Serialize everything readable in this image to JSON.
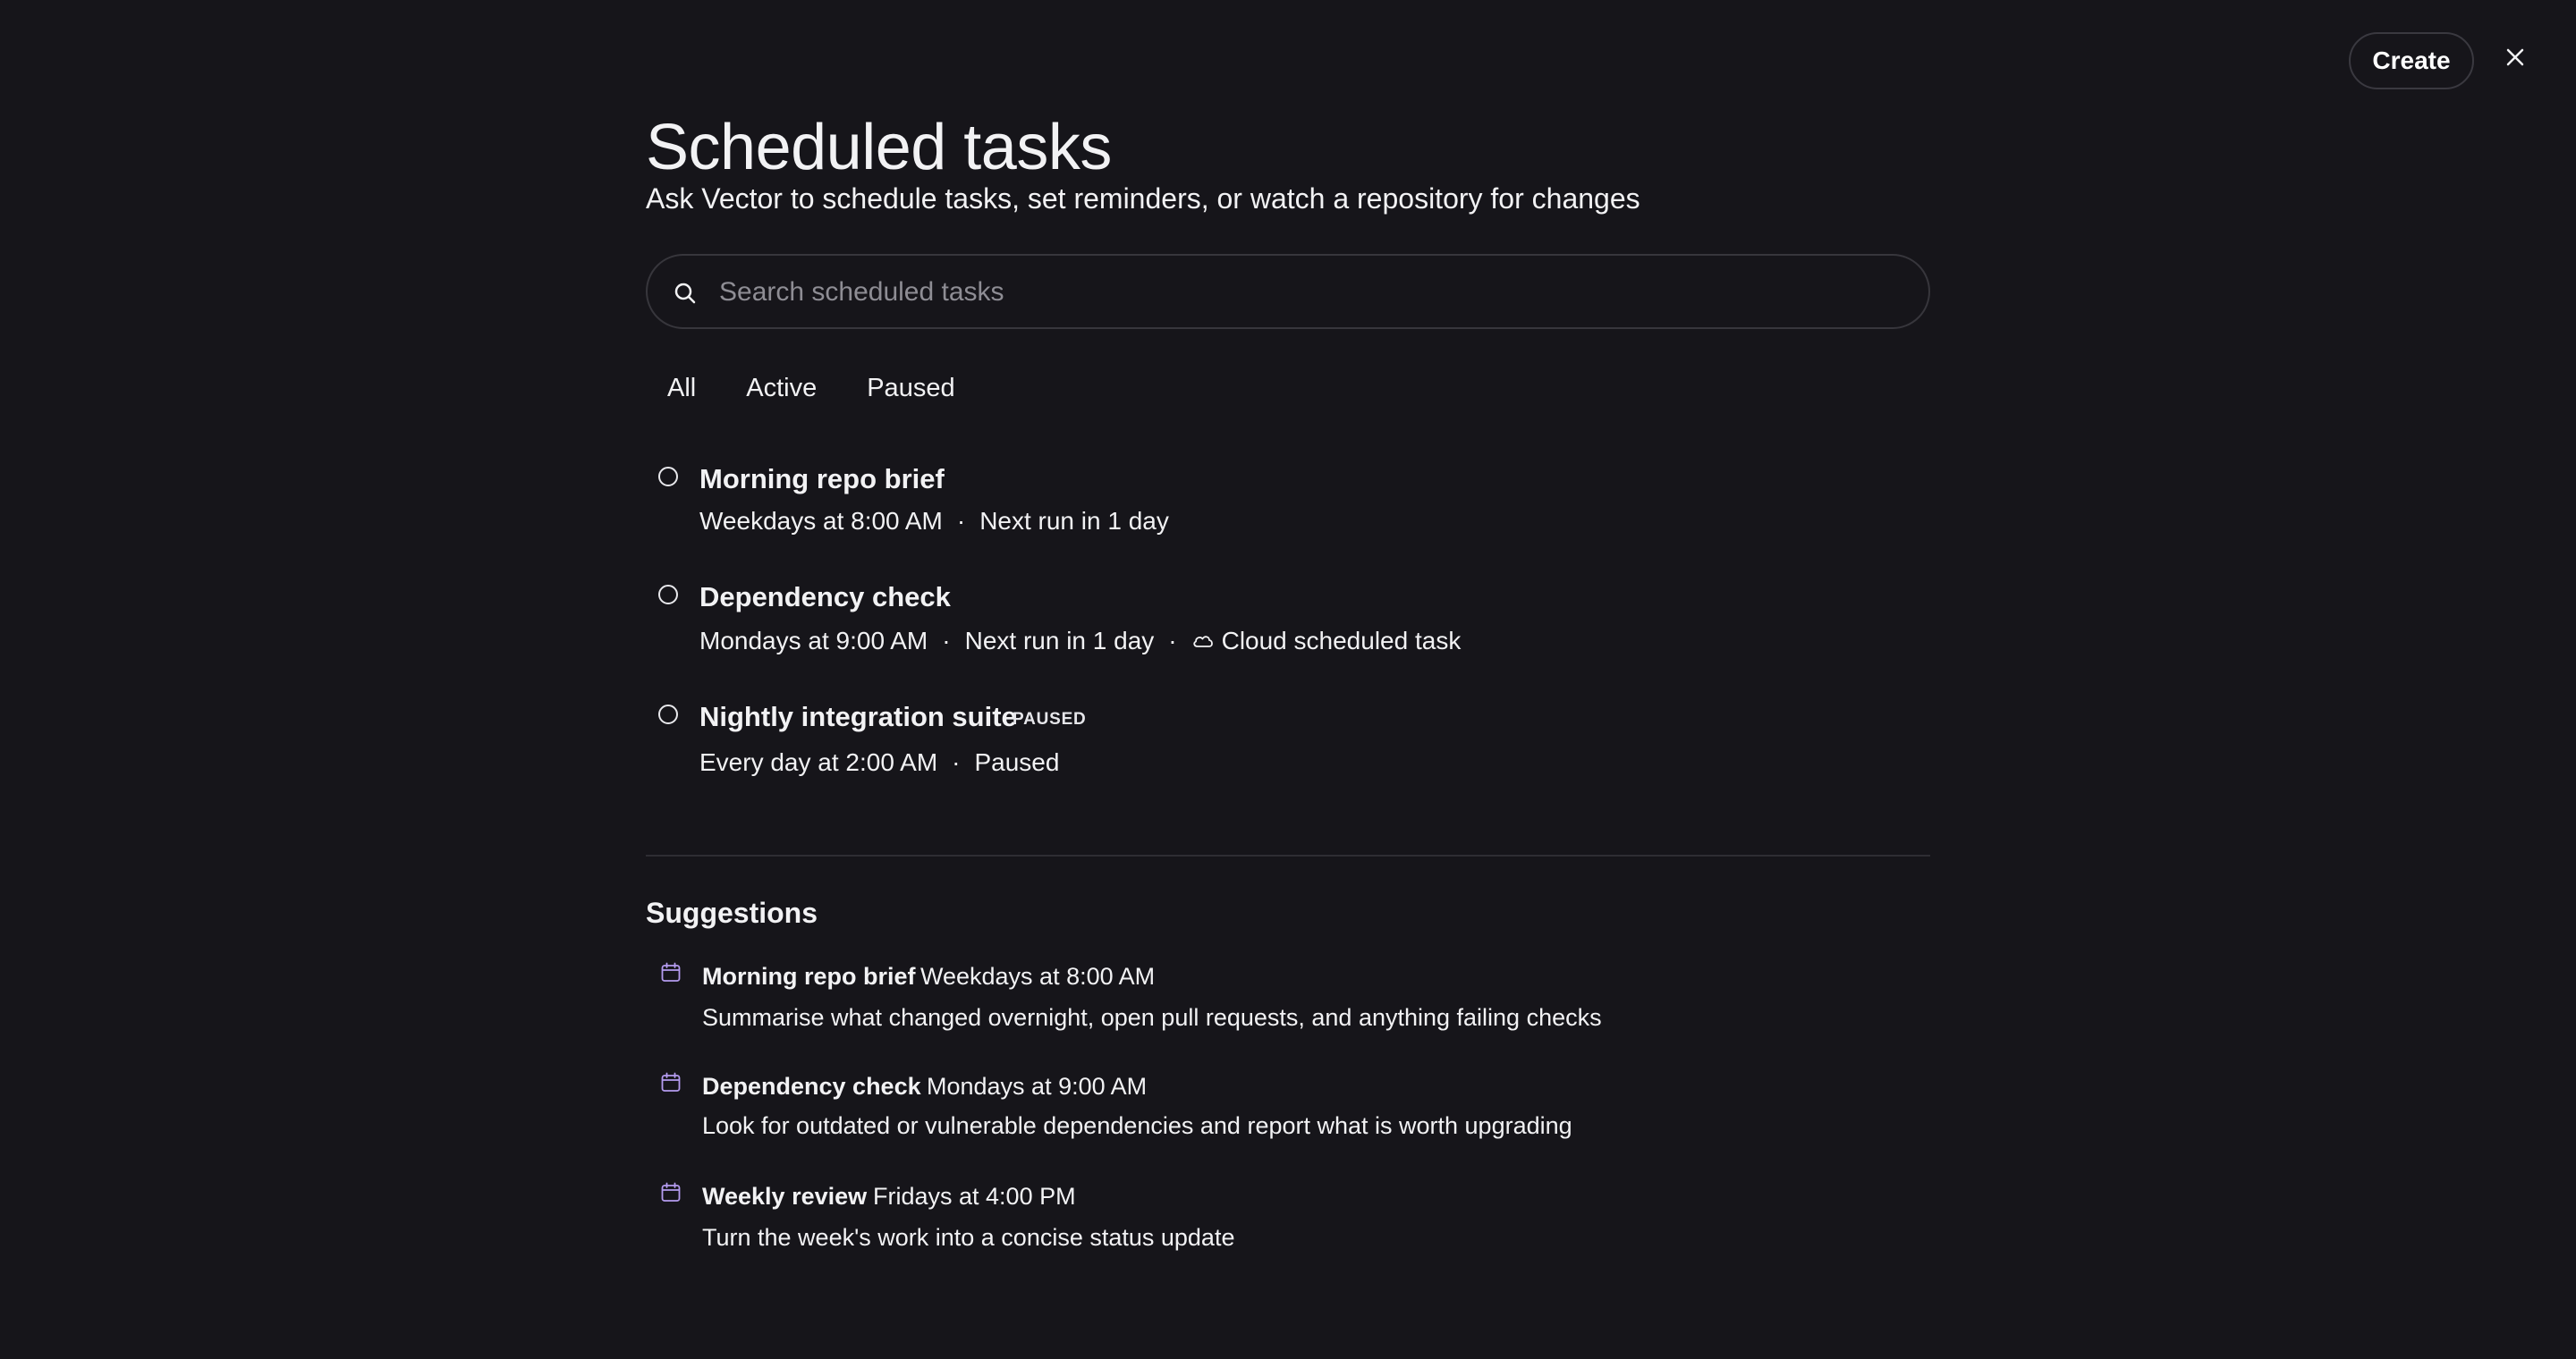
{
  "header": {
    "create_label": "Create",
    "close_icon": "close-icon"
  },
  "page": {
    "title": "Scheduled tasks",
    "subtitle": "Ask Vector to schedule tasks, set reminders, or watch a repository for changes"
  },
  "search": {
    "placeholder": "Search scheduled tasks",
    "value": "",
    "icon": "search-icon"
  },
  "filters": {
    "items": [
      {
        "label": "All"
      },
      {
        "label": "Active"
      },
      {
        "label": "Paused"
      }
    ]
  },
  "tasks": [
    {
      "title": "Morning repo brief",
      "schedule": "Weekdays at 8:00 AM",
      "separator": "·",
      "status": "Next run in 1 day"
    },
    {
      "title": "Dependency check",
      "schedule": "Mondays at 9:00 AM",
      "separator": "·",
      "status": "Next run in 1 day",
      "extra_icon": "cloud-icon",
      "extra": "Cloud scheduled task"
    },
    {
      "title": "Nightly integration suite",
      "badge": "PAUSED",
      "schedule": "Every day at 2:00 AM",
      "separator": "·",
      "status": "Paused"
    }
  ],
  "suggestions": {
    "heading": "Suggestions",
    "icon": "calendar-icon",
    "accent_color": "#b59cf0",
    "items": [
      {
        "title": "Morning repo brief",
        "schedule": "Weekdays at 8:00 AM",
        "description": "Summarise what changed overnight, open pull requests, and anything failing checks"
      },
      {
        "title": "Dependency check",
        "schedule": "Mondays at 9:00 AM",
        "description": "Look for outdated or vulnerable dependencies and report what is worth upgrading"
      },
      {
        "title": "Weekly review",
        "schedule": "Fridays at 4:00 PM",
        "description": "Turn the week's work into a concise status update"
      }
    ]
  },
  "colors": {
    "background": "#16151a",
    "text": "#f2f2f4",
    "border": "#37363c",
    "placeholder": "#8e8d94"
  }
}
